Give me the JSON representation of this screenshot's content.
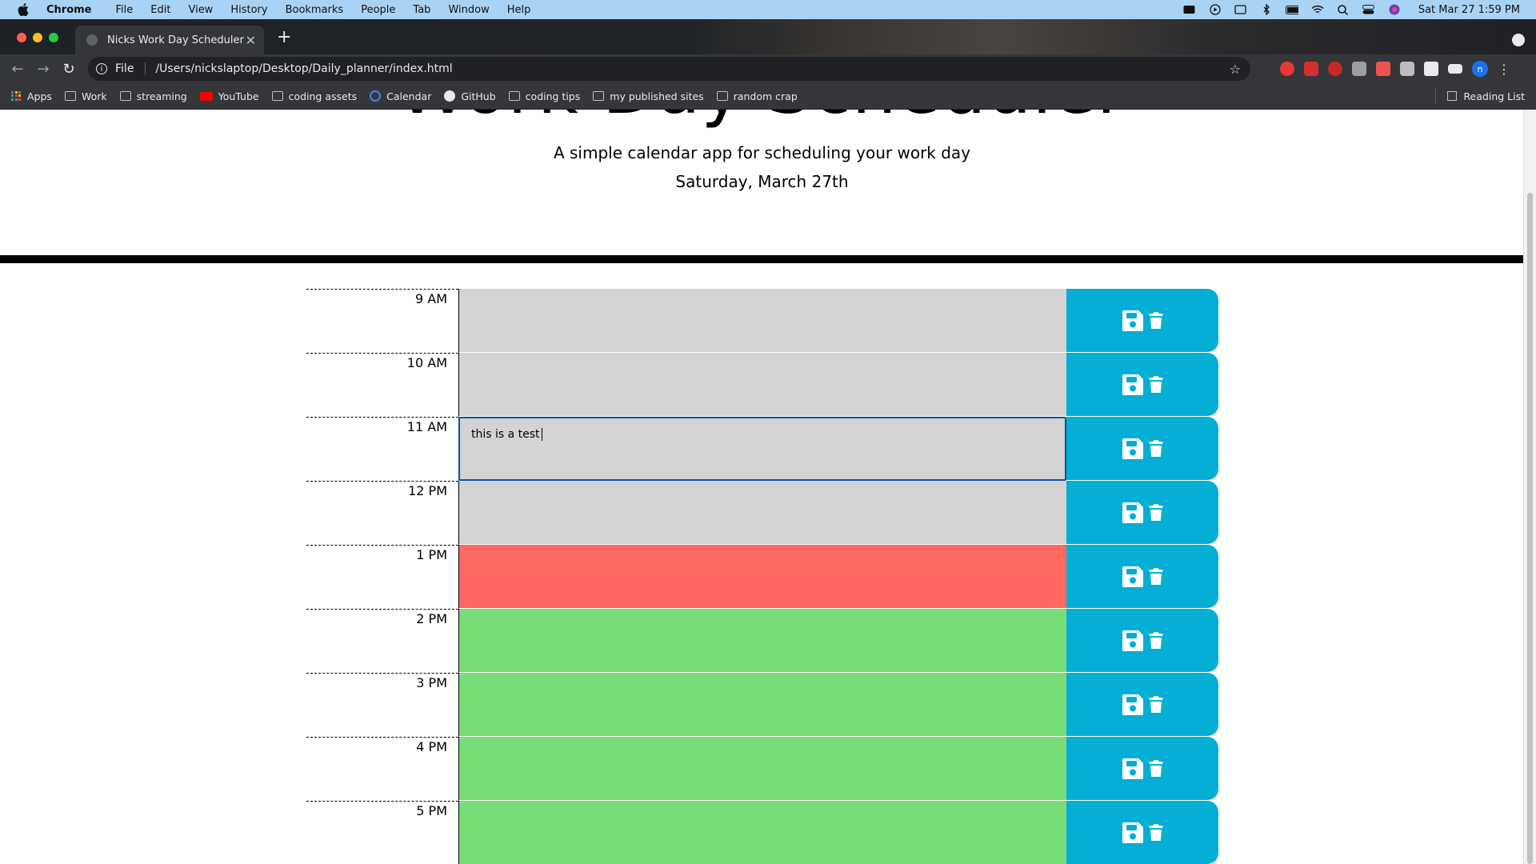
{
  "os_menu": {
    "app": "Chrome",
    "items": [
      "File",
      "Edit",
      "View",
      "History",
      "Bookmarks",
      "People",
      "Tab",
      "Window",
      "Help"
    ],
    "clock": "Sat Mar 27  1:59 PM"
  },
  "browser": {
    "tab_title": "Nicks Work Day Scheduler",
    "scheme": "File",
    "url": "/Users/nickslaptop/Desktop/Daily_planner/index.html",
    "profile_initial": "n",
    "bookmarks": [
      {
        "label": "Apps",
        "icon": "apps-icon"
      },
      {
        "label": "Work",
        "icon": "folder-icon"
      },
      {
        "label": "streaming",
        "icon": "folder-icon"
      },
      {
        "label": "YouTube",
        "icon": "youtube-icon"
      },
      {
        "label": "coding assets",
        "icon": "folder-icon"
      },
      {
        "label": "Calendar",
        "icon": "calendar-icon"
      },
      {
        "label": "GitHub",
        "icon": "github-icon"
      },
      {
        "label": "coding tips",
        "icon": "folder-icon"
      },
      {
        "label": "my published sites",
        "icon": "folder-icon"
      },
      {
        "label": "random crap",
        "icon": "folder-icon"
      }
    ],
    "reading_list": "Reading List"
  },
  "page": {
    "title": "Work Day Scheduler",
    "lead": "A simple calendar app for scheduling your work day",
    "current_day": "Saturday, March 27th"
  },
  "colors": {
    "past": "#d3d3d3",
    "present": "#ff6961",
    "future": "#77dd77",
    "save_block": "#06aed5"
  },
  "hours": [
    {
      "label": "9 AM",
      "status": "past",
      "text": ""
    },
    {
      "label": "10 AM",
      "status": "past",
      "text": ""
    },
    {
      "label": "11 AM",
      "status": "past",
      "text": "this is a test",
      "focused": true
    },
    {
      "label": "12 PM",
      "status": "past",
      "text": ""
    },
    {
      "label": "1 PM",
      "status": "present",
      "text": ""
    },
    {
      "label": "2 PM",
      "status": "future",
      "text": ""
    },
    {
      "label": "3 PM",
      "status": "future",
      "text": ""
    },
    {
      "label": "4 PM",
      "status": "future",
      "text": ""
    },
    {
      "label": "5 PM",
      "status": "future",
      "text": ""
    }
  ]
}
